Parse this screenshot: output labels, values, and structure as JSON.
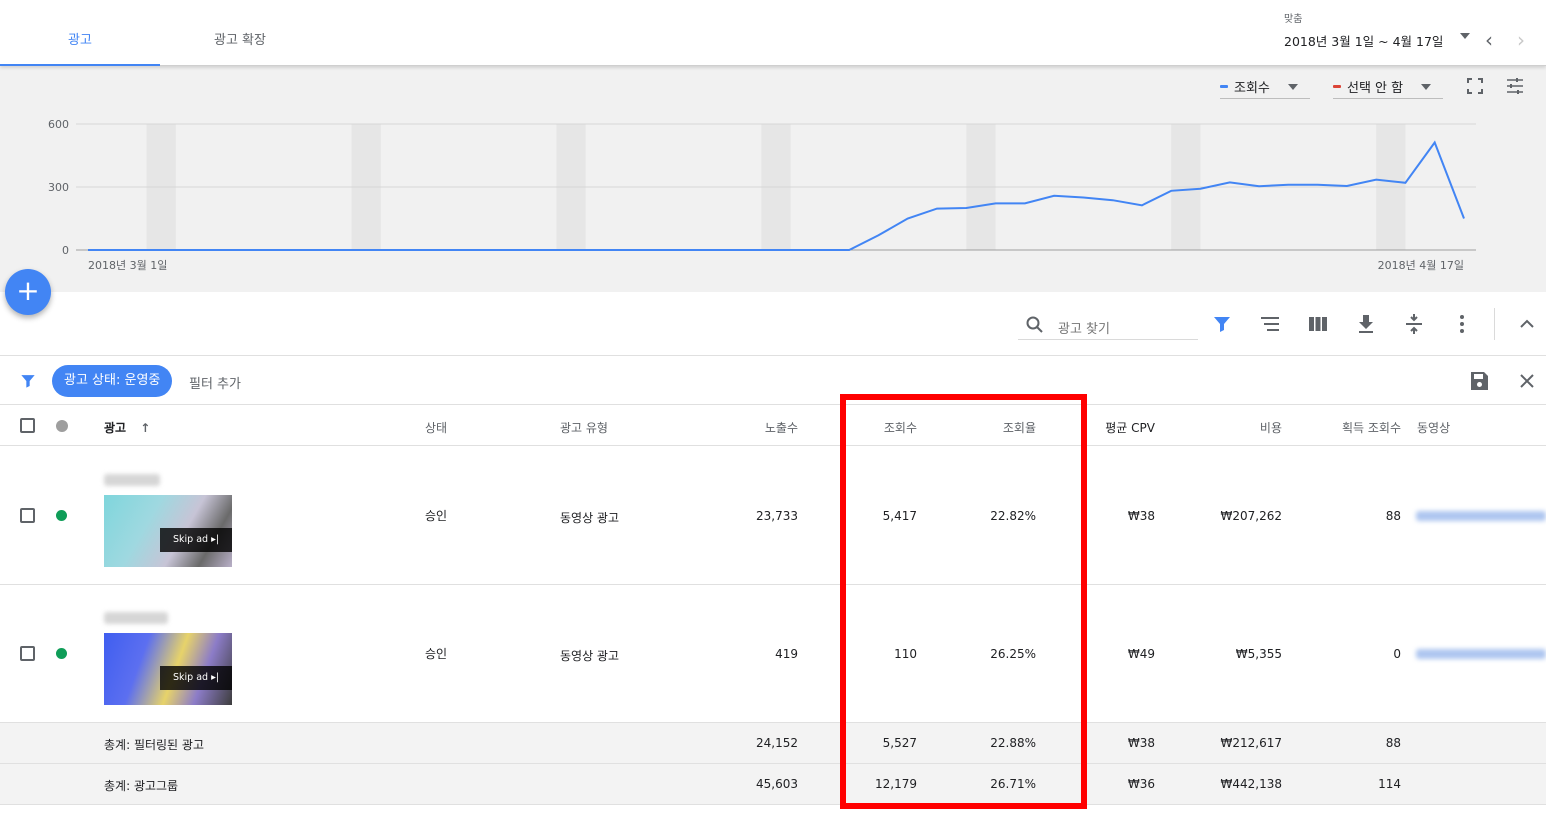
{
  "tabs": [
    {
      "label": "광고",
      "active": true
    },
    {
      "label": "광고 확장",
      "active": false
    }
  ],
  "date_range": {
    "label": "맞춤",
    "value": "2018년 3월 1일 ~ 4월 17일"
  },
  "chart_controls": {
    "metric1": {
      "label": "조회수",
      "color": "#4285f4"
    },
    "metric2": {
      "label": "선택 안 함",
      "color": "#db4437"
    }
  },
  "chart_data": {
    "type": "line",
    "series": [
      {
        "name": "조회수",
        "color": "#4285f4",
        "values": [
          0,
          0,
          0,
          0,
          0,
          0,
          0,
          0,
          0,
          0,
          0,
          0,
          0,
          0,
          0,
          0,
          0,
          0,
          0,
          0,
          0,
          0,
          0,
          0,
          0,
          0,
          0,
          70,
          150,
          197,
          200,
          222,
          222,
          258,
          250,
          237,
          213,
          282,
          292,
          322,
          304,
          311,
          311,
          305,
          335,
          320,
          512,
          150
        ]
      }
    ],
    "x_labels": [
      "2018년 3월 1일",
      "2018년 4월 17일"
    ],
    "y_ticks": [
      0,
      300,
      600
    ],
    "ylim": [
      0,
      600
    ],
    "weekend_bands": true,
    "grid": true
  },
  "toolbar": {
    "search_placeholder": "광고 찾기"
  },
  "filter": {
    "chip": "광고 상태: 운영중",
    "add": "필터 추가"
  },
  "columns": {
    "ad": "광고",
    "status": "상태",
    "ad_type": "광고 유형",
    "impressions": "노출수",
    "views": "조회수",
    "view_rate": "조회율",
    "avg_cpv": "평균 CPV",
    "cost": "비용",
    "earned_views": "획득 조회수",
    "video": "동영상"
  },
  "rows": [
    {
      "status": "승인",
      "ad_type": "동영상 광고",
      "impressions": "23,733",
      "views": "5,417",
      "view_rate": "22.82%",
      "avg_cpv": "₩38",
      "cost": "₩207,262",
      "earned_views": "88",
      "skip": "Skip ad"
    },
    {
      "status": "승인",
      "ad_type": "동영상 광고",
      "impressions": "419",
      "views": "110",
      "view_rate": "26.25%",
      "avg_cpv": "₩49",
      "cost": "₩5,355",
      "earned_views": "0",
      "skip": "Skip ad"
    }
  ],
  "totals": [
    {
      "label": "총계: 필터링된 광고",
      "impressions": "24,152",
      "views": "5,527",
      "view_rate": "22.88%",
      "avg_cpv": "₩38",
      "cost": "₩212,617",
      "earned_views": "88"
    },
    {
      "label": "총계: 광고그룹",
      "impressions": "45,603",
      "views": "12,179",
      "view_rate": "26.71%",
      "avg_cpv": "₩36",
      "cost": "₩442,138",
      "earned_views": "114"
    }
  ]
}
